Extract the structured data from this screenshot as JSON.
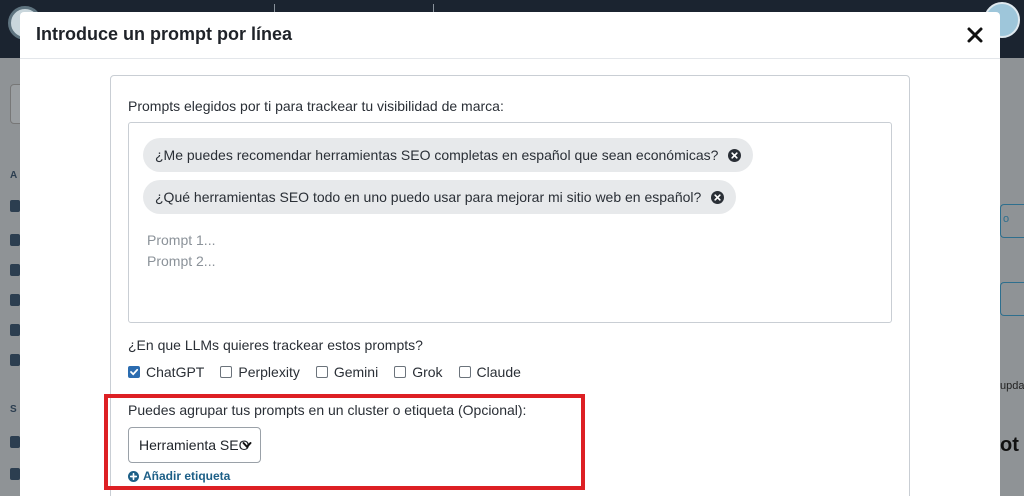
{
  "modal": {
    "title": "Introduce un prompt por línea"
  },
  "prompts": {
    "label": "Prompts elegidos por ti para trackear tu visibilidad de marca:",
    "chips": [
      "¿Me puedes recomendar herramientas SEO completas en español que sean económicas?",
      "¿Qué herramientas SEO todo en uno puedo usar para mejorar mi sitio web en español?"
    ],
    "placeholders": [
      "Prompt 1...",
      "Prompt 2..."
    ]
  },
  "llms": {
    "label": "¿En que LLMs quieres trackear estos prompts?",
    "options": [
      {
        "label": "ChatGPT",
        "checked": true
      },
      {
        "label": "Perplexity",
        "checked": false
      },
      {
        "label": "Gemini",
        "checked": false
      },
      {
        "label": "Grok",
        "checked": false
      },
      {
        "label": "Claude",
        "checked": false
      }
    ]
  },
  "cluster": {
    "label": "Puedes agrupar tus prompts en un cluster o etiqueta (Opcional):",
    "selected": "Herramienta SEO",
    "add_label": "Añadir etiqueta"
  },
  "background": {
    "left_labels": [
      "A",
      "S"
    ],
    "right_texts": [
      "o",
      "upda"
    ],
    "right_big": "ot"
  },
  "colors": {
    "accent": "#2b6cb0",
    "link": "#1d5f87",
    "highlight": "#dd2024"
  }
}
